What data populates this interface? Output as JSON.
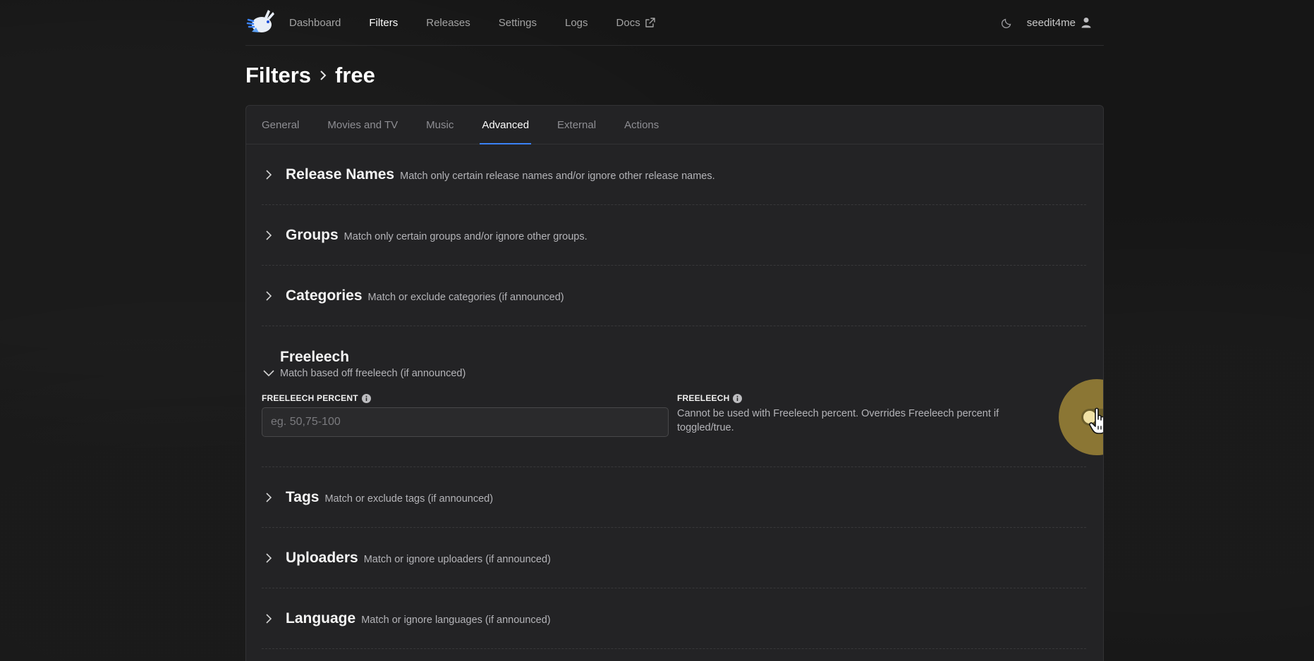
{
  "nav": {
    "items": [
      {
        "label": "Dashboard"
      },
      {
        "label": "Filters"
      },
      {
        "label": "Releases"
      },
      {
        "label": "Settings"
      },
      {
        "label": "Logs"
      },
      {
        "label": "Docs"
      }
    ],
    "active": "Filters",
    "username": "seedit4me"
  },
  "breadcrumb": {
    "root": "Filters",
    "current": "free"
  },
  "tabs": [
    {
      "label": "General"
    },
    {
      "label": "Movies and TV"
    },
    {
      "label": "Music"
    },
    {
      "label": "Advanced"
    },
    {
      "label": "External"
    },
    {
      "label": "Actions"
    }
  ],
  "active_tab": "Advanced",
  "sections": {
    "release_names": {
      "title": "Release Names",
      "desc": "Match only certain release names and/or ignore other release names."
    },
    "groups": {
      "title": "Groups",
      "desc": "Match only certain groups and/or ignore other groups."
    },
    "categories": {
      "title": "Categories",
      "desc": "Match or exclude categories (if announced)"
    },
    "freeleech": {
      "title": "Freeleech",
      "desc": "Match based off freeleech (if announced)",
      "percent_label": "FREELEECH PERCENT",
      "percent_placeholder": "eg. 50,75-100",
      "percent_value": "",
      "toggle_label": "FREELEECH",
      "toggle_help": "Cannot be used with Freeleech percent. Overrides Freeleech percent if toggled/true.",
      "toggle_on": false
    },
    "tags": {
      "title": "Tags",
      "desc": "Match or exclude tags (if announced)"
    },
    "uploaders": {
      "title": "Uploaders",
      "desc": "Match or ignore uploaders (if announced)"
    },
    "language": {
      "title": "Language",
      "desc": "Match or ignore languages (if announced)"
    }
  },
  "colors": {
    "accent": "#3b82f6",
    "highlight": "#8b7634"
  }
}
